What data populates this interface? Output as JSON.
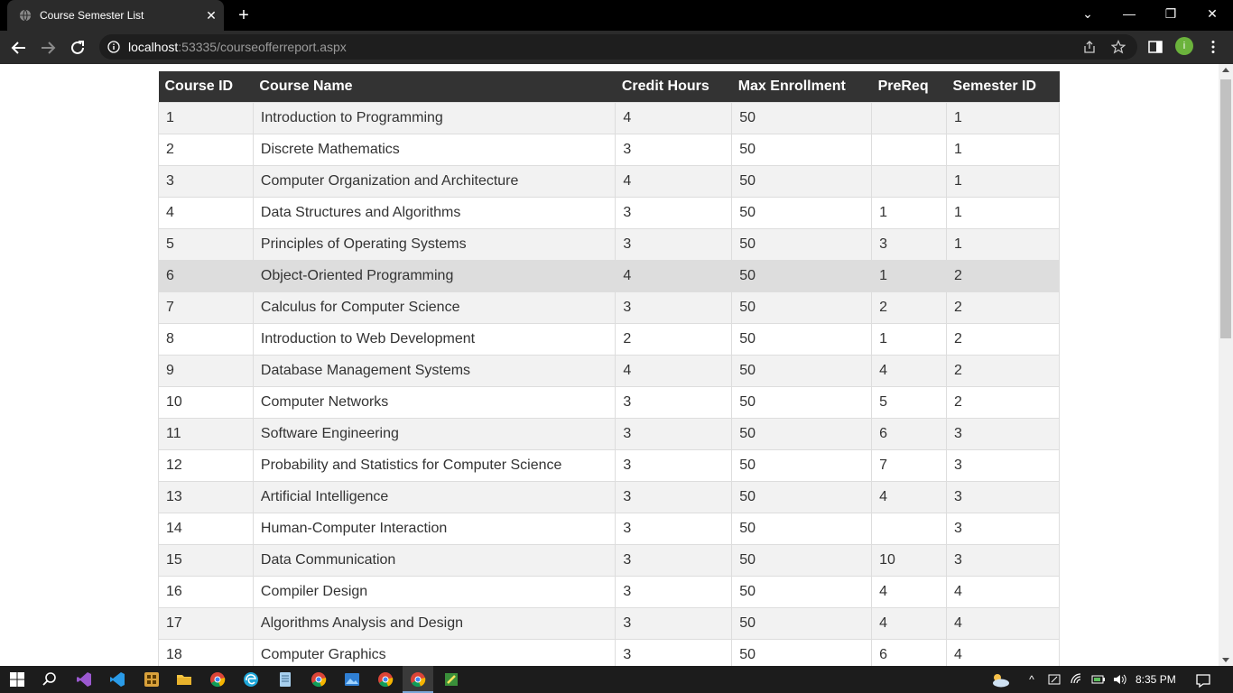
{
  "browser": {
    "tab_title": "Course Semester List",
    "tab_close": "✕",
    "new_tab": "+",
    "url_host": "localhost",
    "url_rest": ":53335/courseofferreport.aspx",
    "profile_initial": "i",
    "window_min": "—",
    "window_max": "❐",
    "window_close": "✕",
    "tab_search": "⌄"
  },
  "table": {
    "headers": [
      "Course ID",
      "Course Name",
      "Credit Hours",
      "Max Enrollment",
      "PreReq",
      "Semester ID"
    ],
    "rows": [
      [
        "1",
        "Introduction to Programming",
        "4",
        "50",
        "",
        "1"
      ],
      [
        "2",
        "Discrete Mathematics",
        "3",
        "50",
        "",
        "1"
      ],
      [
        "3",
        "Computer Organization and Architecture",
        "4",
        "50",
        "",
        "1"
      ],
      [
        "4",
        "Data Structures and Algorithms",
        "3",
        "50",
        "1",
        "1"
      ],
      [
        "5",
        "Principles of Operating Systems",
        "3",
        "50",
        "3",
        "1"
      ],
      [
        "6",
        "Object-Oriented Programming",
        "4",
        "50",
        "1",
        "2"
      ],
      [
        "7",
        "Calculus for Computer Science",
        "3",
        "50",
        "2",
        "2"
      ],
      [
        "8",
        "Introduction to Web Development",
        "2",
        "50",
        "1",
        "2"
      ],
      [
        "9",
        "Database Management Systems",
        "4",
        "50",
        "4",
        "2"
      ],
      [
        "10",
        "Computer Networks",
        "3",
        "50",
        "5",
        "2"
      ],
      [
        "11",
        "Software Engineering",
        "3",
        "50",
        "6",
        "3"
      ],
      [
        "12",
        "Probability and Statistics for Computer Science",
        "3",
        "50",
        "7",
        "3"
      ],
      [
        "13",
        "Artificial Intelligence",
        "3",
        "50",
        "4",
        "3"
      ],
      [
        "14",
        "Human-Computer Interaction",
        "3",
        "50",
        "",
        "3"
      ],
      [
        "15",
        "Data Communication",
        "3",
        "50",
        "10",
        "3"
      ],
      [
        "16",
        "Compiler Design",
        "3",
        "50",
        "4",
        "4"
      ],
      [
        "17",
        "Algorithms Analysis and Design",
        "3",
        "50",
        "4",
        "4"
      ],
      [
        "18",
        "Computer Graphics",
        "3",
        "50",
        "6",
        "4"
      ]
    ]
  },
  "taskbar": {
    "time": "8:35 PM"
  },
  "colors": {
    "header_bg": "#333333",
    "row_alt": "#f2f2f2",
    "row_hover": "#dddddd",
    "browser_dark": "#2b2b2b"
  }
}
